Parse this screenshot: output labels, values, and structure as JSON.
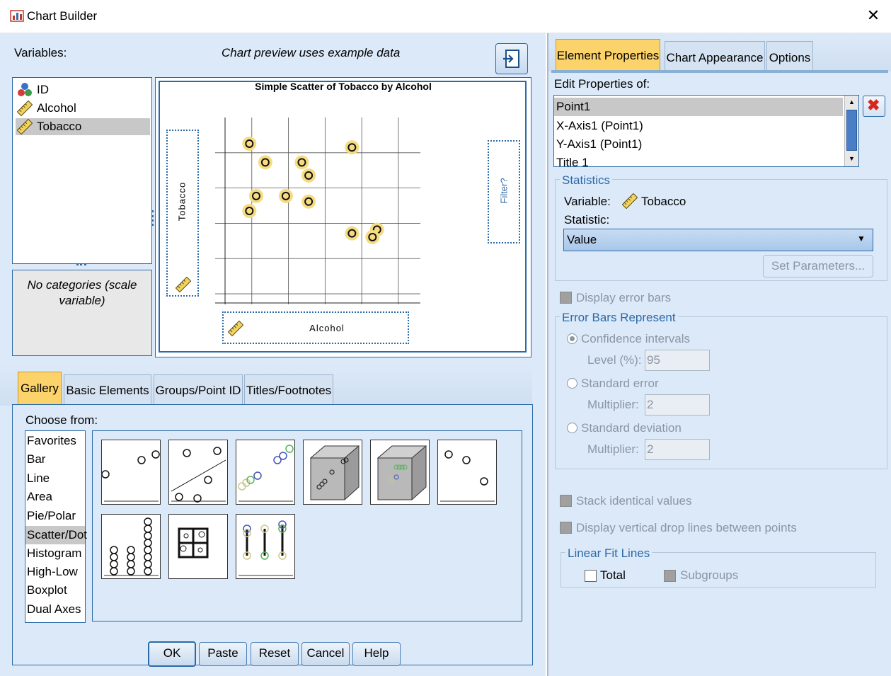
{
  "window": {
    "title": "Chart Builder"
  },
  "variables": {
    "label": "Variables:",
    "items": [
      {
        "name": "ID",
        "icon": "nominal-icon"
      },
      {
        "name": "Alcohol",
        "icon": "scale-ruler-icon"
      },
      {
        "name": "Tobacco",
        "icon": "scale-ruler-icon"
      }
    ],
    "categories_note": "No categories (scale variable)"
  },
  "preview": {
    "note": "Chart preview uses example data",
    "chart_title": "Simple Scatter of Tobacco by Alcohol",
    "y_drop": "Tobacco",
    "x_drop": "Alcohol",
    "filter_drop": "Filter?"
  },
  "chart_data": {
    "type": "scatter",
    "title": "Simple Scatter of Tobacco by Alcohol",
    "xlabel": "Alcohol",
    "ylabel": "Tobacco",
    "points": [
      [
        1.5,
        8.6
      ],
      [
        2.2,
        7.6
      ],
      [
        3.8,
        7.6
      ],
      [
        4.1,
        6.9
      ],
      [
        1.8,
        5.8
      ],
      [
        3.1,
        5.8
      ],
      [
        4.1,
        5.5
      ],
      [
        1.5,
        5.0
      ],
      [
        6.0,
        8.4
      ],
      [
        6.0,
        3.8
      ],
      [
        7.1,
        4.0
      ],
      [
        6.9,
        3.6
      ]
    ],
    "xlim": [
      0,
      9
    ],
    "ylim": [
      0,
      10
    ],
    "grid": true
  },
  "bottom_tabs": [
    {
      "label": "Gallery",
      "active": true
    },
    {
      "label": "Basic Elements",
      "active": false
    },
    {
      "label": "Groups/Point ID",
      "active": false
    },
    {
      "label": "Titles/Footnotes",
      "active": false
    }
  ],
  "gallery": {
    "choose_from": "Choose from:",
    "types": [
      "Favorites",
      "Bar",
      "Line",
      "Area",
      "Pie/Polar",
      "Scatter/Dot",
      "Histogram",
      "High-Low",
      "Boxplot",
      "Dual Axes"
    ],
    "selected": "Scatter/Dot"
  },
  "buttons": {
    "ok": "OK",
    "paste": "Paste",
    "reset": "Reset",
    "cancel": "Cancel",
    "help": "Help"
  },
  "right_tabs": [
    {
      "label": "Element Properties",
      "active": true
    },
    {
      "label": "Chart Appearance",
      "active": false
    },
    {
      "label": "Options",
      "active": false
    }
  ],
  "edit_props": {
    "label": "Edit Properties of:",
    "items": [
      "Point1",
      "X-Axis1 (Point1)",
      "Y-Axis1 (Point1)",
      "Title 1"
    ],
    "selected": "Point1"
  },
  "statistics": {
    "group": "Statistics",
    "variable_label": "Variable:",
    "variable_value": "Tobacco",
    "statistic_label": "Statistic:",
    "statistic_value": "Value",
    "set_params": "Set Parameters..."
  },
  "error_bars": {
    "display": "Display error bars",
    "group": "Error Bars Represent",
    "ci": "Confidence intervals",
    "level_label": "Level (%):",
    "level_value": "95",
    "se": "Standard error",
    "se_mult_label": "Multiplier:",
    "se_mult_value": "2",
    "sd": "Standard deviation",
    "sd_mult_label": "Multiplier:",
    "sd_mult_value": "2"
  },
  "options": {
    "stack": "Stack identical values",
    "droplines": "Display vertical drop lines between points"
  },
  "fit_lines": {
    "group": "Linear Fit Lines",
    "total": "Total",
    "subgroups": "Subgroups"
  },
  "colors": {
    "accent_tab": "#fbd36a",
    "pane_bg": "#dce9f8",
    "point_halo": "#f5dc83",
    "delete_red": "#d9261c"
  }
}
